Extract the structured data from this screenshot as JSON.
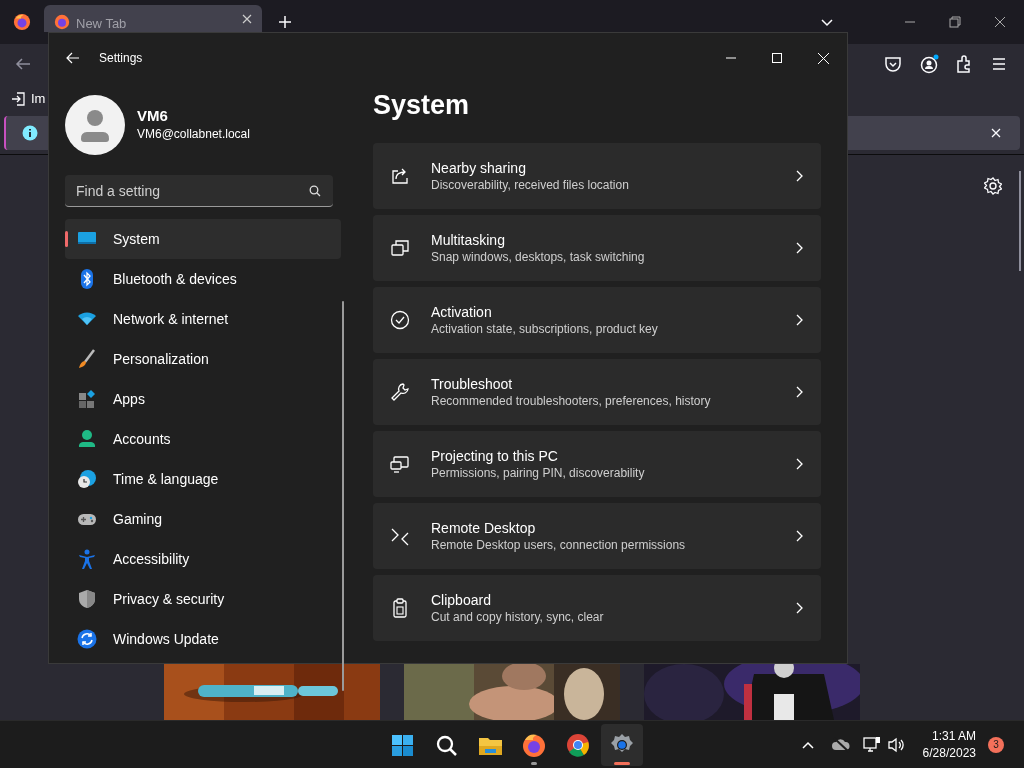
{
  "browser": {
    "tabs": [
      {
        "label": "New Tab",
        "selected": true
      }
    ],
    "bookmark": "Im"
  },
  "settings": {
    "title": "Settings",
    "profile": {
      "name": "VM6",
      "email": "VM6@collabnet.local"
    },
    "search": {
      "placeholder": "Find a setting"
    },
    "nav": {
      "items": [
        {
          "label": "System",
          "selected": true
        },
        {
          "label": "Bluetooth & devices",
          "selected": false
        },
        {
          "label": "Network & internet",
          "selected": false
        },
        {
          "label": "Personalization",
          "selected": false
        },
        {
          "label": "Apps",
          "selected": false
        },
        {
          "label": "Accounts",
          "selected": false
        },
        {
          "label": "Time & language",
          "selected": false
        },
        {
          "label": "Gaming",
          "selected": false
        },
        {
          "label": "Accessibility",
          "selected": false
        },
        {
          "label": "Privacy & security",
          "selected": false
        },
        {
          "label": "Windows Update",
          "selected": false
        }
      ]
    },
    "heading": "System",
    "cards": [
      {
        "title": "Nearby sharing",
        "subtitle": "Discoverability, received files location"
      },
      {
        "title": "Multitasking",
        "subtitle": "Snap windows, desktops, task switching"
      },
      {
        "title": "Activation",
        "subtitle": "Activation state, subscriptions, product key"
      },
      {
        "title": "Troubleshoot",
        "subtitle": "Recommended troubleshooters, preferences, history"
      },
      {
        "title": "Projecting to this PC",
        "subtitle": "Permissions, pairing PIN, discoverability"
      },
      {
        "title": "Remote Desktop",
        "subtitle": "Remote Desktop users, connection permissions"
      },
      {
        "title": "Clipboard",
        "subtitle": "Cut and copy history, sync, clear"
      }
    ]
  },
  "taskbar": {
    "apps": [
      {
        "running": false,
        "selected": false
      },
      {
        "running": false,
        "selected": false
      },
      {
        "running": false,
        "selected": false
      },
      {
        "running": true,
        "selected": false
      },
      {
        "running": false,
        "selected": false
      },
      {
        "running": true,
        "selected": true
      }
    ],
    "time": "1:31 AM",
    "date": "6/28/2023",
    "notification_count": "3"
  }
}
